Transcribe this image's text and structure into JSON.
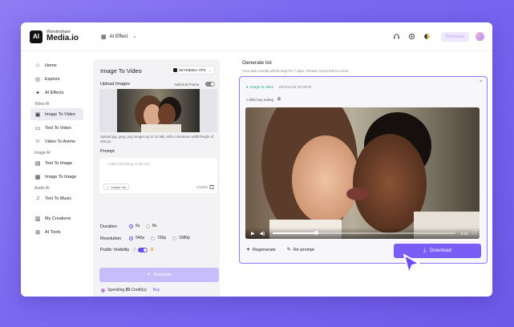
{
  "brand": {
    "small": "Wondershare",
    "name": "Media.io",
    "mark": "AI"
  },
  "header": {
    "ai_effect": "AI Effect",
    "purchase": "Purchase"
  },
  "sidebar": {
    "top_items": [
      {
        "label": "Home",
        "icon": "home-icon"
      },
      {
        "label": "Explore",
        "icon": "compass-icon"
      },
      {
        "label": "AI Effects",
        "icon": "sparkle-icon"
      }
    ],
    "sections": {
      "video_ai": "Video AI",
      "image_ai": "Image AI",
      "audio_ai": "Audio AI"
    },
    "video_items": [
      {
        "label": "Image To Video",
        "active": true
      },
      {
        "label": "Text To Video"
      },
      {
        "label": "Video To Anime"
      }
    ],
    "image_items": [
      {
        "label": "Text To Image"
      },
      {
        "label": "Image To Image"
      }
    ],
    "audio_items": [
      {
        "label": "Text To Music"
      }
    ],
    "bottom_items": [
      {
        "label": "My Creations"
      },
      {
        "label": "AI Tools"
      }
    ]
  },
  "panel": {
    "title": "Image To Video",
    "model": "SKYMEDIA-VP3",
    "upload_label": "Upload Images",
    "keyframe_label": "Add End Frame",
    "upload_note": "Upload jpg, jpeg, png images up to 10 MB, with a minimum width/height of 300 px.",
    "prompt_label": "Prompt",
    "prompt_placeholder": "A little bird flying in the sky",
    "inspire": "Inspire me",
    "counter": "0/1000",
    "duration_label": "Duration",
    "duration_options": [
      "5s",
      "8s"
    ],
    "resolution_label": "Resolution",
    "resolution_options": [
      "540p",
      "720p",
      "1080p"
    ],
    "visibility_label": "Public Visibility",
    "generate": "Generate",
    "spending_prefix": "Spending",
    "spending_value": "20",
    "spending_suffix": "Credit(s)",
    "buy": "Buy"
  },
  "generate_list": {
    "title": "Generate list",
    "subtitle": "Your task results will be kept for 7 days. Please check them in time.",
    "tag": "Image to video",
    "timestamp": "2024/11/25 20:09:00",
    "caption": "A little boy eating",
    "video_time": "-0:05",
    "progress": 0.24,
    "regenerate": "Regenerate",
    "reprompt": "Re-prompt",
    "download": "Download"
  },
  "colors": {
    "accent": "#7a5cf6",
    "accent_light": "#c6bdfa",
    "success": "#1fae6b"
  }
}
